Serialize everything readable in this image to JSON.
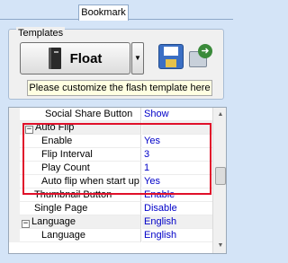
{
  "tabs": {
    "bookmark": "Bookmark"
  },
  "templates": {
    "group_label": "Templates",
    "selected_template": "Float",
    "hint": "Please customize the flash template here"
  },
  "icons": {
    "template_icon": "book-icon",
    "dropdown": "chevron-down-icon",
    "save": "save-icon",
    "export": "export-icon"
  },
  "property_grid": {
    "rows": [
      {
        "name": "Social Share Button",
        "value": "Show",
        "kind": "property"
      },
      {
        "name": "Auto Flip",
        "value": "",
        "kind": "category",
        "expanded": true
      },
      {
        "name": "Enable",
        "value": "Yes",
        "kind": "property"
      },
      {
        "name": "Flip Interval",
        "value": "3",
        "kind": "property"
      },
      {
        "name": "Play Count",
        "value": "1",
        "kind": "property"
      },
      {
        "name": "Auto flip when start up",
        "value": "Yes",
        "kind": "property"
      },
      {
        "name": "Thumbnail Button",
        "value": "Enable",
        "kind": "property"
      },
      {
        "name": "Single Page",
        "value": "Disable",
        "kind": "property"
      },
      {
        "name": "Language",
        "value": "English",
        "kind": "category",
        "expanded": true
      },
      {
        "name": "Language",
        "value": "English",
        "kind": "property"
      }
    ]
  },
  "colors": {
    "highlight": "#e0102a",
    "value_text": "#0000c8",
    "panel_bg": "#d4e4f7",
    "hint_bg": "#ffffe1"
  }
}
